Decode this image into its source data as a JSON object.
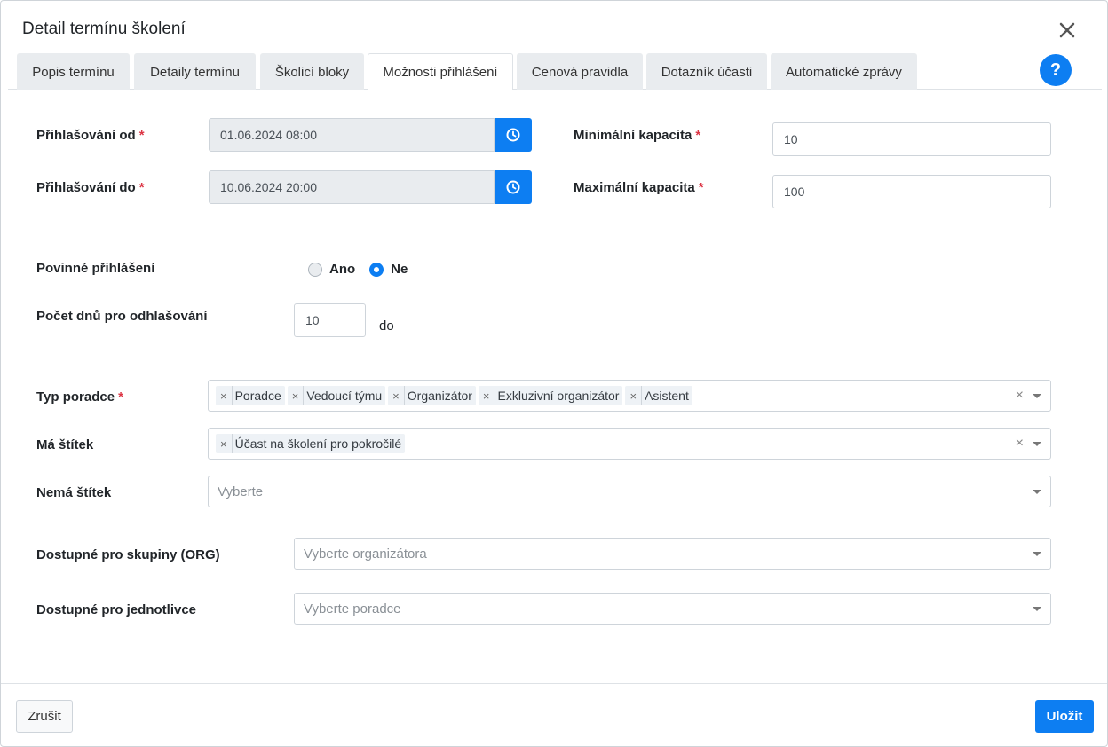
{
  "modal": {
    "title": "Detail termínu školení",
    "help_label": "?"
  },
  "tabs": [
    {
      "label": "Popis termínu"
    },
    {
      "label": "Detaily termínu"
    },
    {
      "label": "Školicí bloky"
    },
    {
      "label": "Možnosti přihlášení",
      "active": true
    },
    {
      "label": "Cenová pravidla"
    },
    {
      "label": "Dotazník účasti"
    },
    {
      "label": "Automatické zprávy"
    }
  ],
  "form": {
    "registration_from": {
      "label": "Přihlašování od",
      "required_mark": "*",
      "value": "01.06.2024 08:00"
    },
    "registration_to": {
      "label": "Přihlašování do",
      "required_mark": "*",
      "value": "10.06.2024 20:00"
    },
    "min_capacity": {
      "label": "Minimální kapacita",
      "required_mark": "*",
      "value": "10"
    },
    "max_capacity": {
      "label": "Maximální kapacita",
      "required_mark": "*",
      "value": "100"
    },
    "mandatory_registration": {
      "label": "Povinné přihlášení",
      "options": [
        "Ano",
        "Ne"
      ],
      "selected": "Ne"
    },
    "unregister_days": {
      "label": "Počet dnů pro odhlašování",
      "value": "10",
      "suffix": "do"
    },
    "advisor_type": {
      "label": "Typ poradce",
      "required_mark": "*",
      "tags": [
        "Poradce",
        "Vedoucí týmu",
        "Organizátor",
        "Exkluzivní organizátor",
        "Asistent"
      ]
    },
    "has_tag": {
      "label": "Má štítek",
      "tags": [
        "Účast na školení pro pokročilé"
      ]
    },
    "no_tag": {
      "label": "Nemá štítek",
      "placeholder": "Vyberte"
    },
    "groups": {
      "label": "Dostupné pro skupiny (ORG)",
      "placeholder": "Vyberte organizátora"
    },
    "individuals": {
      "label": "Dostupné pro jednotlivce",
      "placeholder": "Vyberte poradce"
    }
  },
  "footer": {
    "cancel_label": "Zrušit",
    "save_label": "Uložit"
  },
  "colors": {
    "primary": "#0d7ef2",
    "required": "#dc3545"
  }
}
